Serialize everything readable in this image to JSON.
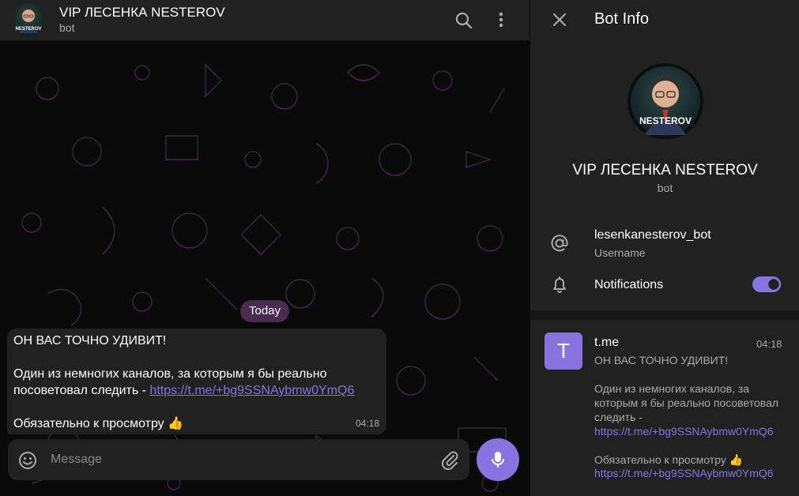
{
  "header": {
    "title": "VIP ЛЕСЕНКА NESTEROV",
    "subtitle": "bot"
  },
  "avatar": {
    "label": "NESTEROV"
  },
  "chat": {
    "date_separator": "Today",
    "message": {
      "line1": "ОН ВАС ТОЧНО УДИВИТ!",
      "line2": "Один из немногих каналов, за которым я бы реально",
      "line3_prefix": "посоветовал следить - ",
      "link": "https://t.me/+bg9SSNAybmw0YmQ6",
      "line4": "Обязательно к просмотру 👍",
      "time": "04:18"
    },
    "composer": {
      "placeholder": "Message"
    }
  },
  "panel": {
    "title": "Bot Info",
    "name": "VIP ЛЕСЕНКА NESTEROV",
    "subtitle": "bot",
    "username": "lesenkanesterov_bot",
    "username_label": "Username",
    "notifications_label": "Notifications",
    "notifications_on": true,
    "shared_link": {
      "thumb_letter": "T",
      "title": "t.me",
      "time": "04:18",
      "line1": "ОН ВАС ТОЧНО УДИВИТ!",
      "line2": "Один из немногих каналов, за которым я бы реально посоветовал следить -",
      "link_inline": "https://t.me/+bg9SSNAybmw0YmQ6",
      "line3": "Обязательно к просмотру 👍",
      "url": "https://t.me/+bg9SSNAybmw0YmQ6"
    }
  },
  "colors": {
    "accent": "#8774e1",
    "surface": "#212121",
    "date_badge": "#4a2b52"
  }
}
